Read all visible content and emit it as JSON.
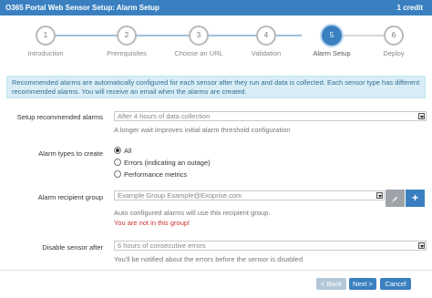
{
  "title": "O365 Portal Web Sensor Setup: Alarm Setup",
  "credits": "1 credit",
  "steps": [
    {
      "num": "1",
      "label": "Introduction"
    },
    {
      "num": "2",
      "label": "Prerequisites"
    },
    {
      "num": "3",
      "label": "Choose an URL"
    },
    {
      "num": "4",
      "label": "Validation"
    },
    {
      "num": "5",
      "label": "Alarm Setup"
    },
    {
      "num": "6",
      "label": "Deploy"
    }
  ],
  "info_text": "Recommended alarms are automatically configured for each sensor after they run and data is collected. Each sensor type has different recommended alarms. You will receive an email when the alarms are created.",
  "setup_alarms": {
    "label": "Setup recommended alarms",
    "value": "After 4 hours of data collection",
    "help": "A longer wait improves initial alarm threshold configuration"
  },
  "alarm_types": {
    "label": "Alarm types to create",
    "options": [
      "All",
      "Errors (indicating an outage)",
      "Performance metrics"
    ],
    "selected": "All"
  },
  "recipient": {
    "label": "Alarm recipient group",
    "value": "Example Group  Example@Exoprise.com",
    "help": "Auto configured alarms will use this recipient group.",
    "error": "You are not in this group!",
    "add_label": "+"
  },
  "disable": {
    "label": "Disable sensor after",
    "value": "6 hours of consecutive errors",
    "help": "You'll be notified about the errors before the sensor is disabled"
  },
  "buttons": {
    "back": "< Back",
    "next": "Next >",
    "cancel": "Cancel"
  }
}
